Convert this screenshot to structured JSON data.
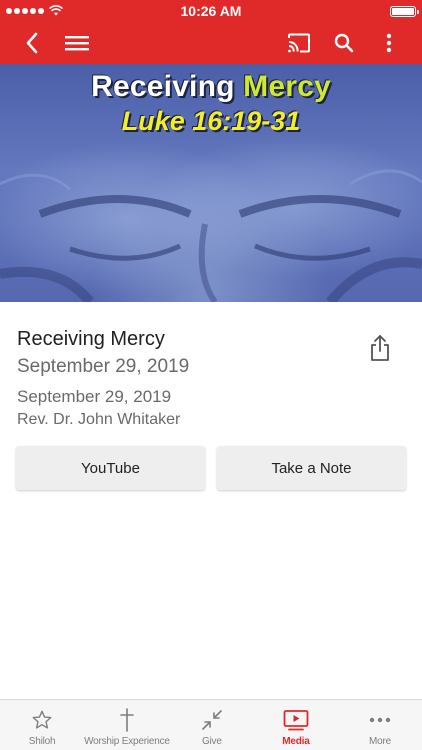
{
  "status_bar": {
    "time": "10:26 AM",
    "signal_icon": "signal-dots-icon",
    "wifi_icon": "wifi-icon",
    "battery_icon": "battery-icon",
    "battery_level": 1.0
  },
  "app_bar": {
    "color": "#e02a2a",
    "back_icon": "chevron-left-icon",
    "menu_icon": "hamburger-menu-icon",
    "cast_icon": "cast-icon",
    "search_icon": "search-icon",
    "more_icon": "more-vertical-icon"
  },
  "hero": {
    "title_part1": "Receiving",
    "title_part2": "Mercy",
    "reference": "Luke 16:19-31"
  },
  "sermon": {
    "title": "Receiving Mercy",
    "date_primary": "September 29, 2019",
    "date_secondary": "September 29, 2019",
    "speaker": "Rev. Dr. John Whitaker",
    "share_icon": "share-icon"
  },
  "actions": {
    "youtube_label": "YouTube",
    "note_label": "Take a Note"
  },
  "tabs": [
    {
      "label": "Shiloh",
      "icon": "star-icon",
      "active": false
    },
    {
      "label": "Worship Experience",
      "icon": "cross-icon",
      "active": false
    },
    {
      "label": "Give",
      "icon": "arrows-icon",
      "active": false
    },
    {
      "label": "Media",
      "icon": "media-play-icon",
      "active": true
    },
    {
      "label": "More",
      "icon": "more-horizontal-icon",
      "active": false
    }
  ],
  "colors": {
    "accent": "#e02a2a",
    "inactive": "#7d7d7d"
  }
}
